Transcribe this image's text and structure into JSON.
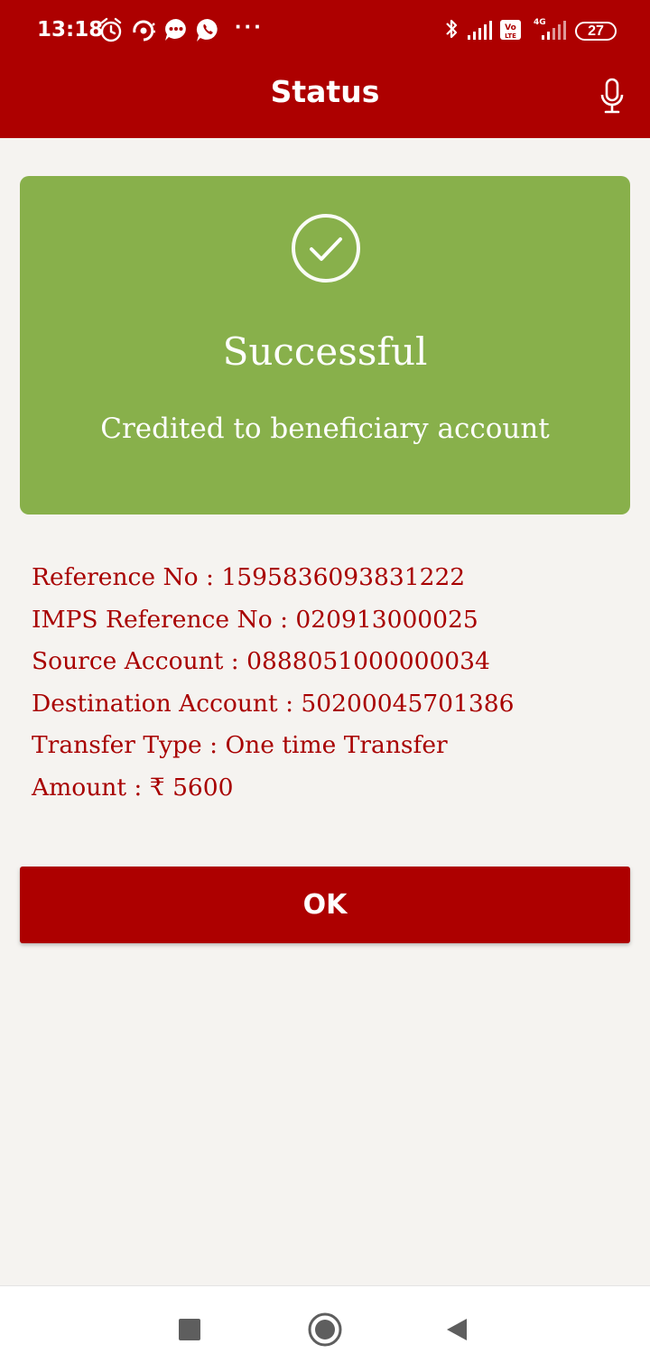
{
  "status_bar": {
    "time": "13:18",
    "battery": "27",
    "network": "4G",
    "volte": "Vo LTE",
    "more": "···"
  },
  "app_bar": {
    "title": "Status",
    "mic_icon": "mic-icon"
  },
  "result": {
    "icon": "check-circle-icon",
    "title": "Successful",
    "subtitle": "Credited to beneficiary account"
  },
  "details": [
    "Reference No : 1595836093831222",
    "IMPS Reference No : 020913000025",
    "Source Account : 0888051000000034",
    "Destination Account : 50200045701386",
    "Transfer Type : One time Transfer",
    "Amount : ₹ 5600"
  ],
  "ok_button": "OK",
  "colors": {
    "brand": "#ad0000",
    "success": "#88b04b",
    "text_red": "#a80000",
    "background": "#f5f3f0"
  }
}
